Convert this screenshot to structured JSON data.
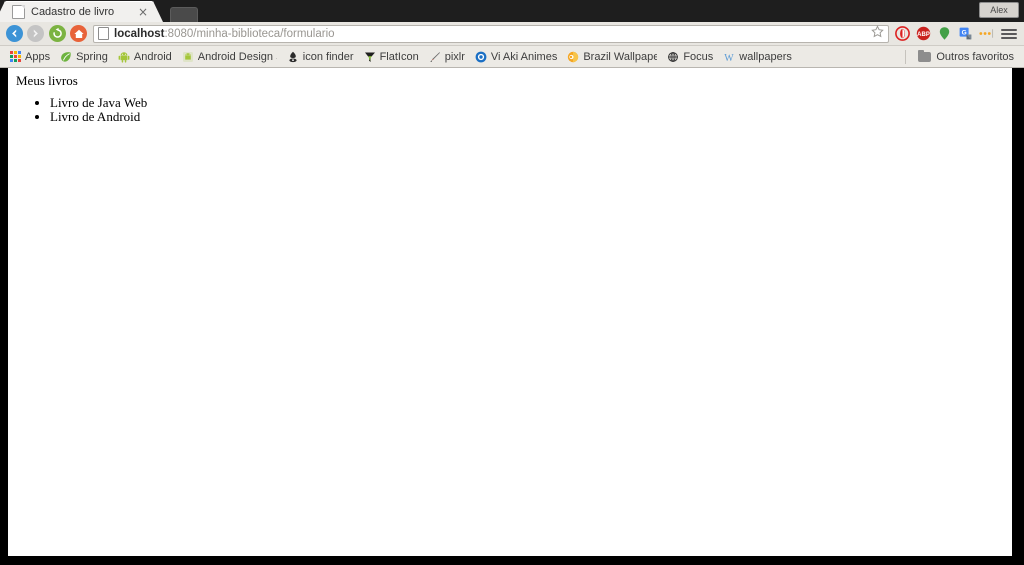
{
  "window": {
    "profile_button_label": "Alex"
  },
  "tabs": [
    {
      "title": "Cadastro de livro",
      "close_glyph": "×",
      "favicon": "page-icon"
    }
  ],
  "toolbar": {
    "back": "back-arrow",
    "forward": "forward-arrow",
    "reload": "reload-arrow",
    "home": "home-house",
    "url_host": "localhost",
    "url_rest": ":8080/minha-biblioteca/formulario",
    "url_full": "localhost:8080/minha-biblioteca/formulario",
    "extensions": [
      {
        "name": "opera-shield-extension",
        "color": "#dd2020"
      },
      {
        "name": "adblock-plus-extension",
        "label": "ABP",
        "color": "#c9221f"
      },
      {
        "name": "map-pin-extension",
        "color": "#43a047"
      },
      {
        "name": "google-docs-extension",
        "color": "#4285f4"
      },
      {
        "name": "more-dots-extension",
        "color": "#f5a623"
      }
    ]
  },
  "bookmarks": {
    "items": [
      {
        "label": "Apps",
        "icon": "apps-grid-icon"
      },
      {
        "label": "Spring",
        "icon": "spring-leaf-icon"
      },
      {
        "label": "Android",
        "icon": "android-robot-icon"
      },
      {
        "label": "Android Design Sup",
        "icon": "android-robot-icon"
      },
      {
        "label": "icon finder",
        "icon": "iconfinder-icon"
      },
      {
        "label": "FlatIcon",
        "icon": "flaticon-icon"
      },
      {
        "label": "pixlr",
        "icon": "pixlr-brush-icon"
      },
      {
        "label": "Vi Aki Animes",
        "icon": "viaki-circle-icon"
      },
      {
        "label": "Brazil Wallpapers -",
        "icon": "brazil-wallpapers-icon"
      },
      {
        "label": "Focus",
        "icon": "focus-globe-icon"
      },
      {
        "label": "wallpapers",
        "icon": "wallpapers-w-icon"
      }
    ],
    "other_label": "Outros favoritos",
    "other_icon": "folder-icon"
  },
  "page": {
    "heading": "Meus livros",
    "books": [
      "Livro de Java Web",
      "Livro de Android"
    ]
  }
}
